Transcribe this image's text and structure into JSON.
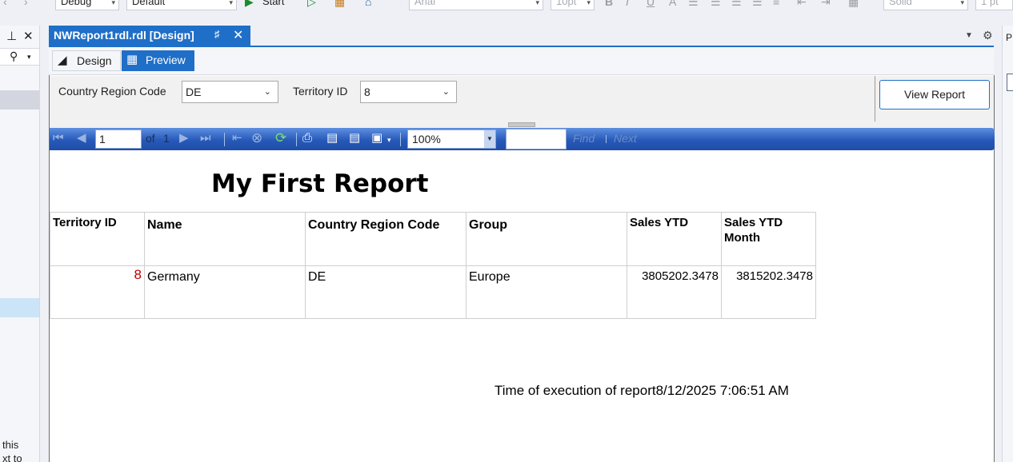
{
  "toolbar": {
    "config": "Debug",
    "platform": "Default",
    "start_label": "Start",
    "font_name": "Arial",
    "font_size": "10pt",
    "border_style": "Solid",
    "border_width": "1 pt"
  },
  "left_panel": {
    "help_line1": "this",
    "help_line2": "xt to"
  },
  "right_panel": {
    "letter": "P"
  },
  "document_tab": {
    "title": "NWReport1rdl.rdl [Design]"
  },
  "view_tabs": [
    {
      "label": "Design",
      "icon": "design-ruler-icon"
    },
    {
      "label": "Preview",
      "icon": "preview-icon",
      "active": true
    }
  ],
  "parameters": {
    "country_label": "Country Region Code",
    "country_value": "DE",
    "territory_label": "Territory ID",
    "territory_value": "8",
    "view_report_label": "View Report"
  },
  "report_toolbar": {
    "page_value": "1",
    "of_label": "of",
    "total_pages": "1",
    "zoom_value": "100%",
    "find_label": "Find",
    "next_label": "Next"
  },
  "report": {
    "title": "My First Report",
    "columns": [
      "Territory ID",
      "Name",
      "Country Region Code",
      "Group",
      "Sales YTD",
      "Sales YTD Month"
    ],
    "rows": [
      {
        "territory_id": "8",
        "name": "Germany",
        "country_region_code": "DE",
        "group": "Europe",
        "sales_ytd": "3805202.3478",
        "sales_ytd_month": "3815202.3478"
      }
    ],
    "execution_label": "Time of execution of report",
    "execution_time": "8/12/2025 7:06:51 AM"
  },
  "colors": {
    "accent": "#1f6fc8",
    "territory_id_value": "#c00000"
  }
}
